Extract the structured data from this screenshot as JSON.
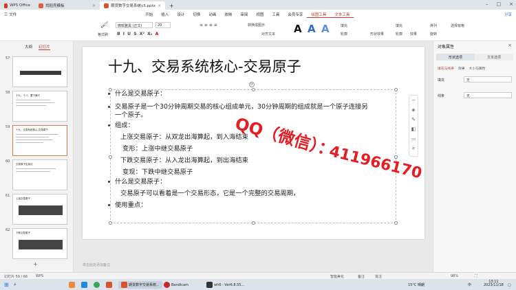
{
  "tabs": [
    {
      "label": "WPS Office"
    },
    {
      "label": "找稻壳模板"
    },
    {
      "label": "期货数字交易系统v3.pptx"
    }
  ],
  "menu": {
    "file": "三 文件",
    "items": [
      "开始",
      "插入",
      "设计",
      "切换",
      "动画",
      "放映",
      "审阅",
      "视图",
      "工具",
      "会员专享",
      "绘图工具",
      "文本工具"
    ],
    "share": "分享"
  },
  "ribbon": {
    "format_brush": "格式刷",
    "font_name": "微软雅黑 (正文)",
    "font_size": "20",
    "convert_picture": "转换成图示",
    "align_text": "对齐文本",
    "fill": "填充",
    "outline": "轮廓",
    "shape_fill": "填充",
    "shape_outline": "轮廓",
    "shape_effect": "形状效果",
    "effect": "效果",
    "arrange": "排列",
    "rotate": "旋转",
    "select": "选择窗格"
  },
  "left_panel": {
    "tab_outline": "大纲",
    "tab_slides": "幻灯片",
    "thumbs": [
      {
        "num": "57",
        "title": ""
      },
      {
        "num": "58",
        "title": "十七、十八、要下面行"
      },
      {
        "num": "59",
        "title": "十九、交易系统核心-交易原子"
      },
      {
        "num": "60",
        "title": "交易原子应用法"
      },
      {
        "num": "61",
        "title": "上涨交易原子"
      },
      {
        "num": "62",
        "title": "下跌交易原子"
      }
    ]
  },
  "slide": {
    "title": "十九、交易系统核心-交易原子",
    "lines": [
      {
        "bullet": true,
        "text": "什么是交易原子："
      },
      {
        "bullet": true,
        "text": "交易原子是一个30分钟周期交易的核心组成单元，30分钟周期的组成就是一个原子连接另"
      },
      {
        "bullet": false,
        "text": "一个原子。"
      },
      {
        "bullet": true,
        "text": "组成："
      },
      {
        "bullet": false,
        "text": "上涨交易原子：从双龙出海算起，到入海结束"
      },
      {
        "bullet": false,
        "text": "变形：上涨中继交易原子"
      },
      {
        "bullet": false,
        "text": "下跌交易原子：从入龙出海算起，到出海结束"
      },
      {
        "bullet": false,
        "text": "变现：下跌中继交易原子"
      },
      {
        "bullet": true,
        "text": "什么是交易原子："
      },
      {
        "bullet": false,
        "text": "交易原子可以看着是一个交易形态，它是一个完整的交易周期，"
      },
      {
        "bullet": true,
        "text": "使用重点："
      }
    ],
    "overlay_qq": "QQ（微信）：",
    "overlay_num": "411966170"
  },
  "notes": "单击此处添加备注",
  "right_panel": {
    "title": "对象属性",
    "tab1": "形状选项",
    "tab2": "文本选项",
    "sub": [
      "填充与线条",
      "效果",
      "大小与属性"
    ],
    "fill_label": "填充",
    "fill_value": "无",
    "line_label": "线条",
    "line_value": "无"
  },
  "status": {
    "page": "幻灯片 59 / 66",
    "app": "WPS",
    "beautify": "智能美化",
    "notes_btn": "备注",
    "comments": "批注",
    "zoom": "98%"
  },
  "taskbar": {
    "apps": [
      "期货数字交易系统...",
      "Bandicam",
      "wh6 - Ver6.8.55..."
    ],
    "weather": "15°C 晴朗",
    "ime": "中",
    "time": "13:11",
    "date": "2023/11/18"
  },
  "colors": {
    "accent": "#c0392b",
    "overlay": "#e31e24"
  }
}
